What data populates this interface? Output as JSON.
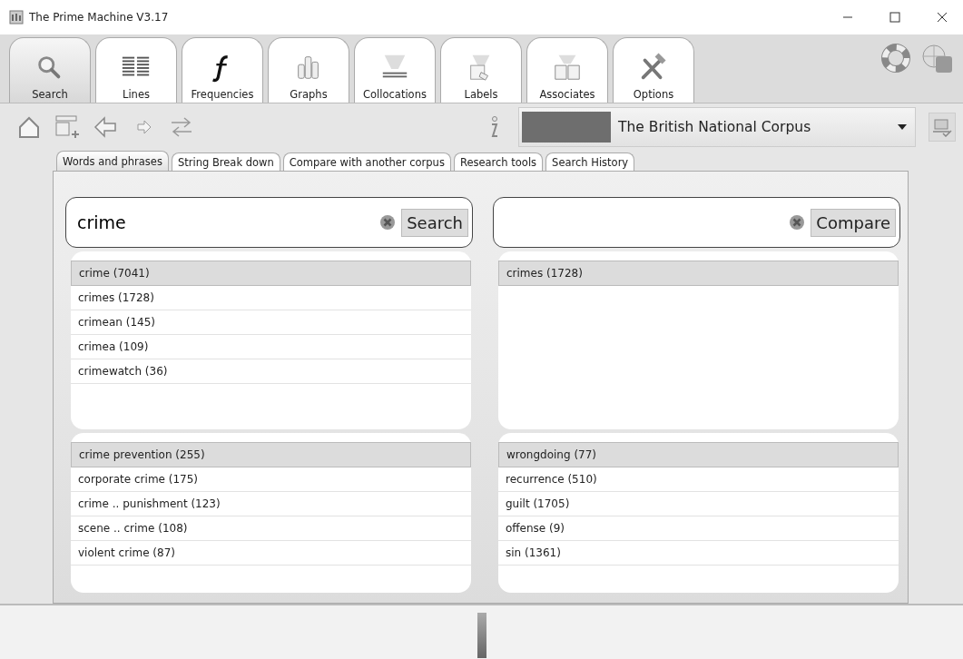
{
  "window": {
    "title": "The Prime Machine V3.17"
  },
  "main_tabs": [
    {
      "label": "Search",
      "selected": true
    },
    {
      "label": "Lines",
      "selected": false
    },
    {
      "label": "Frequencies",
      "selected": false
    },
    {
      "label": "Graphs",
      "selected": false
    },
    {
      "label": "Collocations",
      "selected": false
    },
    {
      "label": "Labels",
      "selected": false
    },
    {
      "label": "Associates",
      "selected": false
    },
    {
      "label": "Options",
      "selected": false
    }
  ],
  "corpus_select": {
    "value": "The British National Corpus"
  },
  "sub_tabs": [
    {
      "label": "Words and phrases",
      "selected": true
    },
    {
      "label": "String Break down",
      "selected": false
    },
    {
      "label": "Compare with another corpus",
      "selected": false
    },
    {
      "label": "Research tools",
      "selected": false
    },
    {
      "label": "Search History",
      "selected": false
    }
  ],
  "search": {
    "value": "crime",
    "button": "Search"
  },
  "compare": {
    "button": "Compare"
  },
  "lists": [
    {
      "items": [
        {
          "text": "crime (7041)",
          "selected": true
        },
        {
          "text": "crimes (1728)",
          "selected": false
        },
        {
          "text": "crimean (145)",
          "selected": false
        },
        {
          "text": "crimea (109)",
          "selected": false
        },
        {
          "text": "crimewatch (36)",
          "selected": false
        }
      ]
    },
    {
      "items": [
        {
          "text": "crimes (1728)",
          "selected": true
        }
      ]
    },
    {
      "items": [
        {
          "text": "crime prevention (255)",
          "selected": true
        },
        {
          "text": "corporate crime (175)",
          "selected": false
        },
        {
          "text": "crime .. punishment (123)",
          "selected": false
        },
        {
          "text": "scene .. crime (108)",
          "selected": false
        },
        {
          "text": "violent crime (87)",
          "selected": false
        }
      ]
    },
    {
      "items": [
        {
          "text": "wrongdoing (77)",
          "selected": true
        },
        {
          "text": "recurrence (510)",
          "selected": false
        },
        {
          "text": "guilt (1705)",
          "selected": false
        },
        {
          "text": "offense (9)",
          "selected": false
        },
        {
          "text": "sin (1361)",
          "selected": false
        }
      ]
    }
  ]
}
